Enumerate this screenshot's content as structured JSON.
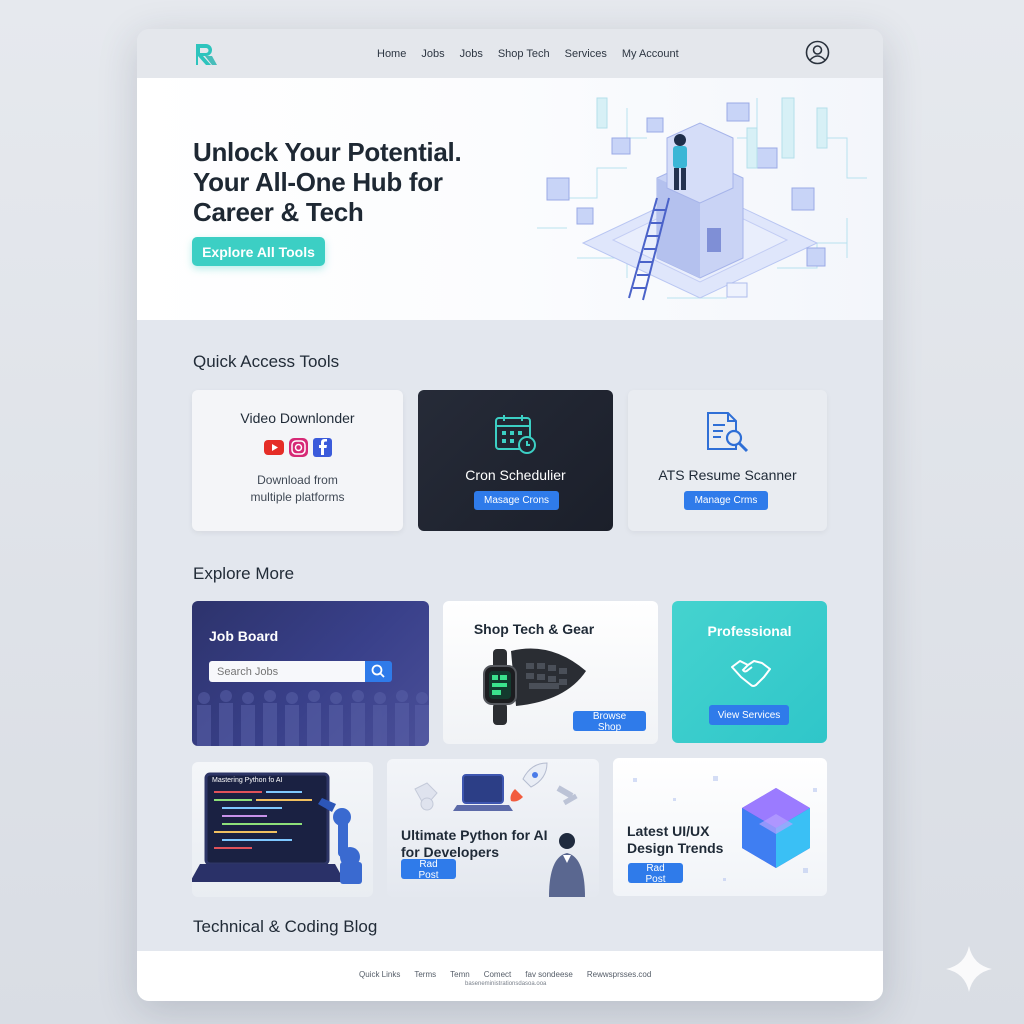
{
  "nav": {
    "links": [
      "Home",
      "Jobs",
      "Jobs",
      "Shop Tech",
      "Services",
      "My Account"
    ]
  },
  "hero": {
    "title_line1": "Unlock Your Potential.",
    "title_line2": "Your All-One Hub for",
    "title_line3": "Career & Tech",
    "cta_label": "Explore All Tools"
  },
  "quick_access": {
    "title": "Quick Access Tools",
    "video": {
      "title": "Video Downlonder",
      "desc_line1": "Download from",
      "desc_line2": "multiple platforms"
    },
    "cron": {
      "title": "Cron Schedulier",
      "button": "Masage Crons"
    },
    "ats": {
      "title": "ATS Resume Scanner",
      "button": "Manage Crms"
    }
  },
  "explore": {
    "title": "Explore More",
    "job_board": {
      "title": "Job Board",
      "search_placeholder": "Search Jobs"
    },
    "shop": {
      "title": "Shop Tech & Gear",
      "button": "Browse Shop"
    },
    "professional": {
      "title": "Professional",
      "button": "View Services"
    }
  },
  "blog": {
    "title": "Technical & Coding Blog",
    "post1": {
      "screen_text": "Mastering Python fo AI"
    },
    "post2": {
      "title_line1": "Ultimate Python for AI",
      "title_line2": "for Developers",
      "button": "Rad Post"
    },
    "post3": {
      "title_line1": "Latest UI/UX",
      "title_line2": "Design Trends",
      "button": "Rad Post"
    }
  },
  "footer": {
    "links": [
      "Quick Links",
      "Terms",
      "Temn",
      "Comect",
      "fav sondeese",
      "Rewwsprsses.cod"
    ],
    "sub": "baseneministrationsdasoa.ooa"
  },
  "colors": {
    "accent": "#3ccfc4",
    "primary_button": "#2f7bea",
    "dark_card": "#1f2430",
    "job_board": "#353c80"
  }
}
